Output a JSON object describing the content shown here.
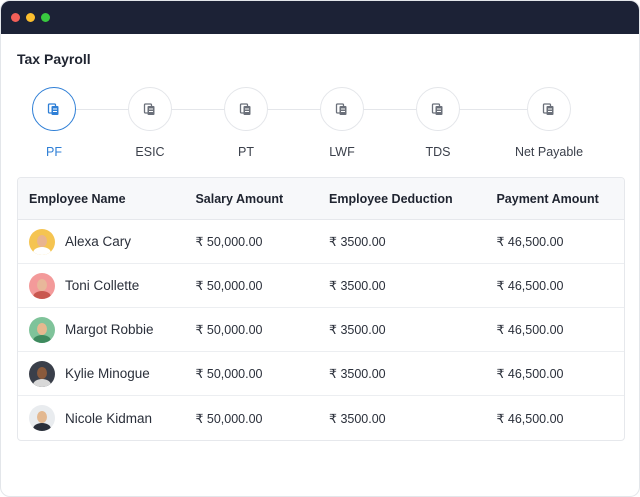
{
  "window": {
    "dots": [
      "#f25f58",
      "#fbbe2e",
      "#38c93f"
    ]
  },
  "page": {
    "title": "Tax Payroll"
  },
  "accent": "#2f7fd6",
  "steps": [
    {
      "label": "PF",
      "icon": "document-stack-icon",
      "active": true
    },
    {
      "label": "ESIC",
      "icon": "document-stack-icon",
      "active": false
    },
    {
      "label": "PT",
      "icon": "document-stack-icon",
      "active": false
    },
    {
      "label": "LWF",
      "icon": "document-stack-icon",
      "active": false
    },
    {
      "label": "TDS",
      "icon": "document-stack-icon",
      "active": false
    },
    {
      "label": "Net Payable",
      "icon": "document-stack-icon",
      "active": false
    }
  ],
  "table": {
    "headers": [
      "Employee Name",
      "Salary Amount",
      "Employee Deduction",
      "Payment Amount"
    ],
    "rows": [
      {
        "name": "Alexa Cary",
        "salary": "₹ 50,000.00",
        "deduction": "₹ 3500.00",
        "payment": "₹ 46,500.00",
        "avatar_bg": "#f5c451",
        "avatar_face": "#e9b48f",
        "avatar_body": "#ffffff"
      },
      {
        "name": "Toni Collette",
        "salary": "₹ 50,000.00",
        "deduction": "₹ 3500.00",
        "payment": "₹ 46,500.00",
        "avatar_bg": "#f39a9a",
        "avatar_face": "#e8b79a",
        "avatar_body": "#c9574f"
      },
      {
        "name": "Margot Robbie",
        "salary": "₹ 50,000.00",
        "deduction": "₹ 3500.00",
        "payment": "₹ 46,500.00",
        "avatar_bg": "#7fc39a",
        "avatar_face": "#e6b88f",
        "avatar_body": "#3e8a5e"
      },
      {
        "name": "Kylie Minogue",
        "salary": "₹ 50,000.00",
        "deduction": "₹ 3500.00",
        "payment": "₹ 46,500.00",
        "avatar_bg": "#3a3f4a",
        "avatar_face": "#8a5a3c",
        "avatar_body": "#d8d8d8"
      },
      {
        "name": "Nicole Kidman",
        "salary": "₹ 50,000.00",
        "deduction": "₹ 3500.00",
        "payment": "₹ 46,500.00",
        "avatar_bg": "#e9ecef",
        "avatar_face": "#e3b890",
        "avatar_body": "#2a2f3a"
      }
    ]
  }
}
